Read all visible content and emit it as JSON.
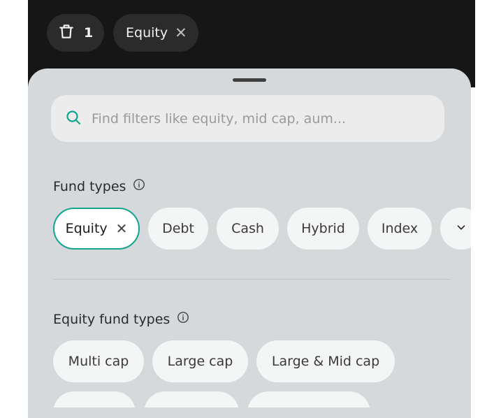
{
  "top_bar": {
    "delete_count": "1",
    "active_filter": "Equity",
    "active_filter_close": "✕"
  },
  "search": {
    "placeholder": "Find filters like equity, mid cap, aum..."
  },
  "fund_types": {
    "title": "Fund types",
    "selected_close": "✕",
    "chips": [
      "Equity",
      "Debt",
      "Cash",
      "Hybrid",
      "Index"
    ]
  },
  "equity_fund_types": {
    "title": "Equity fund types",
    "chips": [
      "Multi cap",
      "Large cap",
      "Large & Mid cap"
    ]
  },
  "colors": {
    "accent": "#12a58e",
    "sheet_bg": "#d6d9db",
    "top_bar_bg": "#161616"
  },
  "icons": [
    "delete-icon",
    "close-icon",
    "search-icon",
    "info-icon",
    "chevron-down-icon"
  ]
}
